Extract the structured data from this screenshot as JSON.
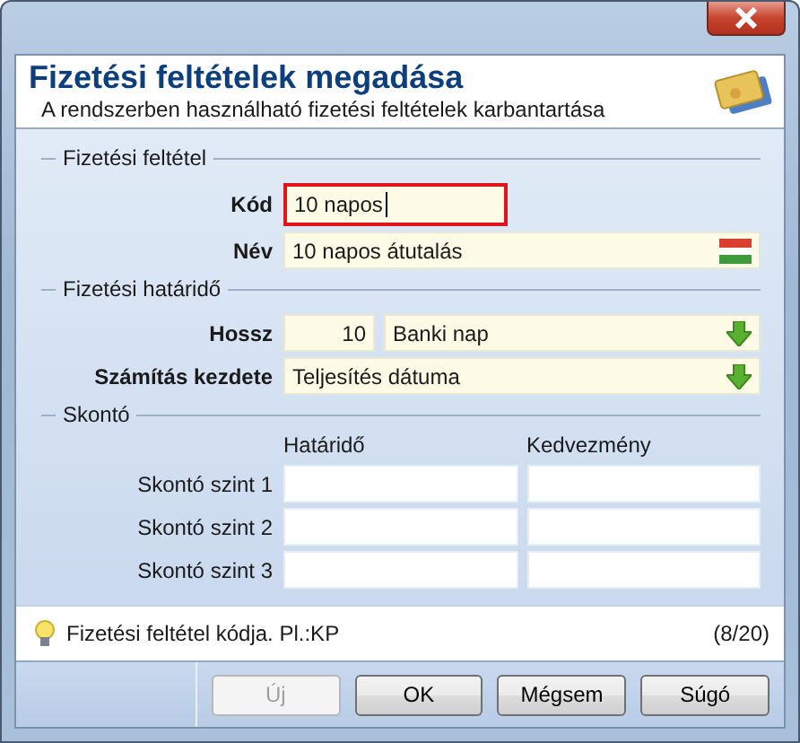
{
  "header": {
    "title": "Fizetési feltételek megadása",
    "subtitle": "A rendszerben használható fizetési feltételek karbantartása"
  },
  "sections": [
    {
      "title": "Fizetési feltétel",
      "rows": [
        {
          "label": "Kód",
          "fields": [
            {
              "kind": "text",
              "value": "10 napos",
              "focused": true
            }
          ]
        },
        {
          "label": "Név",
          "fields": [
            {
              "kind": "translatable",
              "value": "10 napos átutalás",
              "focused": false
            }
          ]
        }
      ]
    },
    {
      "title": "Fizetési határidő",
      "rows": [
        {
          "label": "Hossz",
          "fields": [
            {
              "kind": "number",
              "value": "10",
              "focused": false
            },
            {
              "kind": "combo",
              "value": "Banki nap",
              "focused": false
            }
          ]
        },
        {
          "label": "Számítás kezdete",
          "fields": [
            {
              "kind": "combo",
              "value": "Teljesítés dátuma",
              "focused": false
            }
          ]
        }
      ]
    },
    {
      "title": "Skontó",
      "grid": {
        "columns": [
          "Határidő",
          "Kedvezmény"
        ],
        "rows": [
          {
            "label": "Skontó szint 1"
          },
          {
            "label": "Skontó szint 2"
          },
          {
            "label": "Skontó szint 3"
          }
        ]
      }
    }
  ],
  "status": {
    "hint": "Fizetési feltétel kódja. Pl.:KP",
    "counter": "(8/20)"
  },
  "buttons": [
    {
      "label": "Új",
      "disabled": true
    },
    {
      "label": "OK",
      "disabled": false
    },
    {
      "label": "Mégsem",
      "disabled": false
    },
    {
      "label": "Súgó",
      "disabled": false
    }
  ]
}
